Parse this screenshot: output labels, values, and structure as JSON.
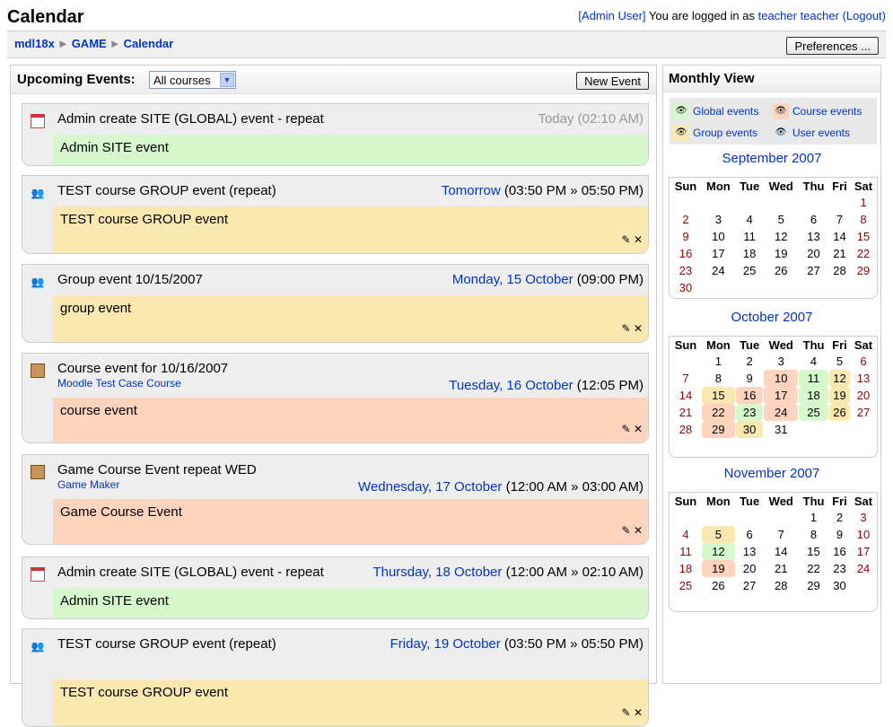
{
  "page_title": "Calendar",
  "login": {
    "admin": "[Admin User]",
    "text": " You are logged in as ",
    "user": "teacher teacher",
    "logout": "(Logout)"
  },
  "breadcrumb": {
    "site": "mdl18x",
    "course": "GAME",
    "page": "Calendar",
    "sep": "►"
  },
  "preferences_label": "Preferences ...",
  "upcoming": {
    "label": "Upcoming Events:",
    "filter_value": "All courses",
    "new_event_label": "New Event",
    "events": [
      {
        "type": "site",
        "name": "Admin create SITE (GLOBAL) event - repeat",
        "course": "",
        "day": "",
        "time": "Today (02:10 AM)",
        "desc": "Admin SITE event",
        "editable": false
      },
      {
        "type": "group",
        "name": "TEST course GROUP event (repeat)",
        "course": "",
        "day": "Tomorrow",
        "time": "(03:50 PM » 05:50 PM)",
        "desc": "TEST course GROUP event",
        "editable": true
      },
      {
        "type": "group",
        "name": "Group event 10/15/2007",
        "course": "",
        "day": "Monday, 15 October",
        "time": "(09:00 PM)",
        "desc": "group event",
        "editable": true
      },
      {
        "type": "course",
        "name": "Course event for 10/16/2007",
        "course": "Moodle Test Case Course",
        "day": "Tuesday, 16 October",
        "time": "(12:05 PM)",
        "desc": "course event",
        "editable": true
      },
      {
        "type": "course",
        "name": "Game Course Event repeat WED",
        "course": "Game Maker",
        "day": "Wednesday, 17 October",
        "time": "(12:00 AM » 03:00 AM)",
        "desc": "Game Course Event",
        "editable": true
      },
      {
        "type": "site",
        "name": "Admin create SITE (GLOBAL) event - repeat",
        "course": "",
        "day": "Thursday, 18 October",
        "time": "(12:00 AM » 02:10 AM)",
        "desc": "Admin SITE event",
        "editable": false
      },
      {
        "type": "group",
        "name": "TEST course GROUP event (repeat)",
        "course": "",
        "day": "Friday, 19 October",
        "time": "(03:50 PM » 05:50 PM)",
        "desc": "TEST course GROUP event",
        "editable": true
      }
    ]
  },
  "monthly": {
    "title": "Monthly View",
    "legend": {
      "global": "Global events",
      "course": "Course events",
      "group": "Group events",
      "user": "User events"
    },
    "weekdays": [
      "Sun",
      "Mon",
      "Tue",
      "Wed",
      "Thu",
      "Fri",
      "Sat"
    ],
    "months": [
      {
        "name": "September 2007",
        "start": 6,
        "days": 30,
        "marks": {}
      },
      {
        "name": "October 2007",
        "start": 1,
        "days": 31,
        "marks": {
          "10": "course",
          "11": "global",
          "12": "group",
          "15": "group",
          "16": "course",
          "17": "course",
          "18": "global",
          "19": "group",
          "22": "course",
          "23": "global",
          "24": "course",
          "25": "global",
          "26": "group",
          "29": "course",
          "30": "group"
        }
      },
      {
        "name": "November 2007",
        "start": 4,
        "days": 30,
        "marks": {
          "5": "group",
          "12": "global",
          "19": "course"
        }
      }
    ]
  },
  "colors": {
    "global": "#d6f8cd",
    "group": "#fbe8b0",
    "course": "#ffd3bd",
    "link": "#0033cc",
    "weekend": "#990000"
  },
  "icons": {
    "site": "calendar-icon",
    "group": "group-people-icon",
    "course": "course-book-icon",
    "edit": "edit-icon",
    "delete": "delete-icon",
    "show": "eye-icon"
  }
}
